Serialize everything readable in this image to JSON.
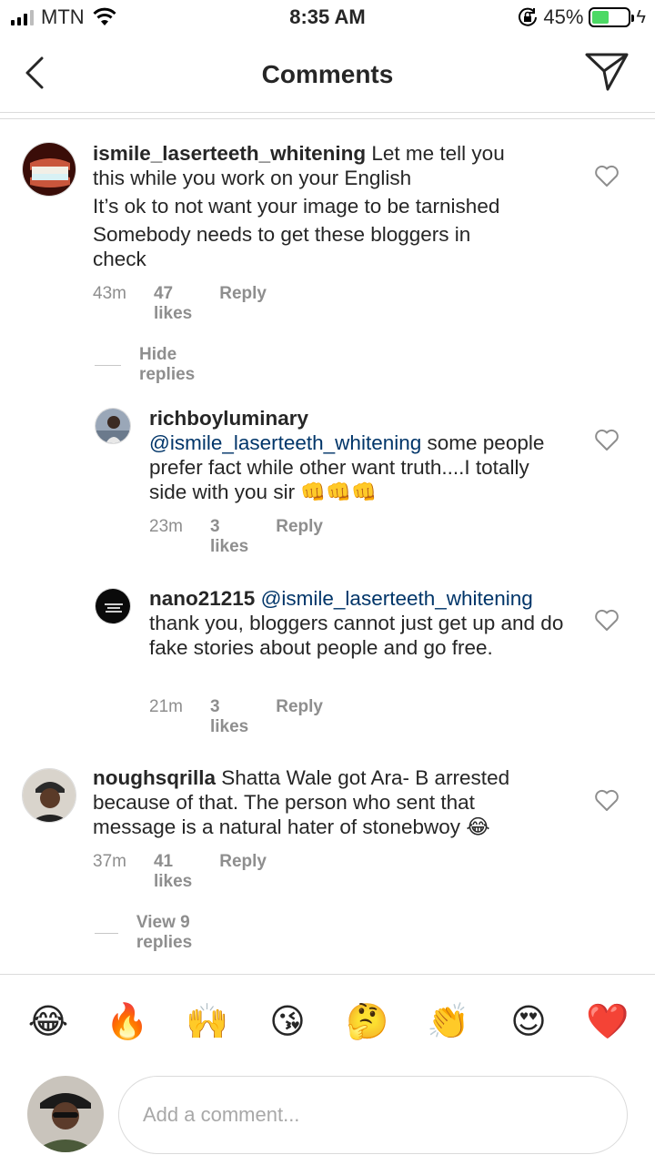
{
  "status_bar": {
    "carrier": "MTN",
    "time": "8:35 AM",
    "battery_percent": "45%",
    "battery_level": 0.45,
    "battery_color": "#4cd964"
  },
  "header": {
    "title": "Comments",
    "back_icon": "chevron-left-icon",
    "send_icon": "paper-plane-icon"
  },
  "comments": [
    {
      "username": "ismile_laserteeth_whitening",
      "text_line1": "Let me tell you",
      "text_rest": "this while you work on your English",
      "text_line3": "It’s ok to not want your image to be tarnished",
      "text_line4": "Somebody needs to get these bloggers in check",
      "time": "43m",
      "likes": "47 likes",
      "reply": "Reply",
      "replies_toggle": "Hide replies",
      "replies": [
        {
          "username": "richboyluminary",
          "mention": "@ismile_laserteeth_whitening",
          "text": "some people prefer fact while other want truth....I totally side with you sir 👊👊👊",
          "time": "23m",
          "likes": "3 likes",
          "reply": "Reply"
        },
        {
          "username": "nano21215",
          "mention": "@ismile_laserteeth_whitening",
          "text": "thank you, bloggers cannot just get up and do fake stories about people and go free.",
          "time": "21m",
          "likes": "3 likes",
          "reply": "Reply"
        }
      ]
    },
    {
      "username": "noughsqrilla",
      "text": "Shatta Wale got Ara- B arrested because of that. The person who sent that message is a natural hater of stonebwoy 😂",
      "time": "37m",
      "likes": "41 likes",
      "reply": "Reply",
      "replies_toggle": "View 9 replies"
    }
  ],
  "emoji_bar": [
    "😂",
    "🔥",
    "🙌",
    "😘",
    "🤔",
    "👏",
    "😍",
    "❤️"
  ],
  "composer": {
    "placeholder": "Add a comment..."
  },
  "colors": {
    "mention": "#003569",
    "meta": "#8e8e8e",
    "divider": "#dbdbdb"
  }
}
